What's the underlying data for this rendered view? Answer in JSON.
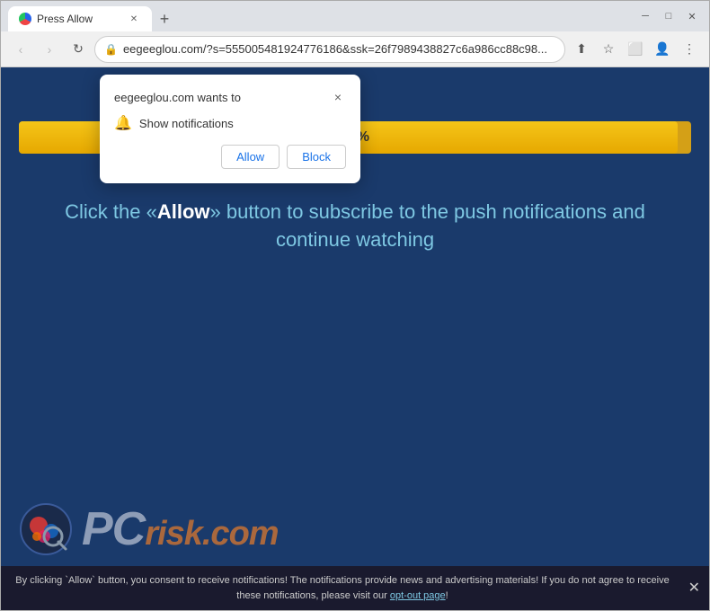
{
  "browser": {
    "tab_title": "Press Allow",
    "new_tab_label": "+",
    "address": "eegeeglou.com/?s=555005481924776186&ssk=26f7989438827c6a986cc88c98...",
    "nav": {
      "back_label": "‹",
      "forward_label": "›",
      "refresh_label": "↻"
    },
    "window_controls": {
      "minimize": "─",
      "maximize": "□",
      "close": "✕"
    }
  },
  "notification_popup": {
    "title": "eegeeglou.com wants to",
    "close_label": "×",
    "item_text": "Show notifications",
    "allow_label": "Allow",
    "block_label": "Block"
  },
  "page": {
    "progress_percent": "98%",
    "progress_fill_width": "98",
    "main_message_part1": "Click the «",
    "main_message_allow": "Allow",
    "main_message_part2": "» button to subscribe to the push notifications and continue watching",
    "logo_text_pc": "PC",
    "logo_text_risk": "risk",
    "logo_text_com": ".com"
  },
  "cookie_bar": {
    "text": "By clicking `Allow` button, you consent to receive notifications! The notifications provide news and advertising materials! If you do not agree to receive these notifications, please visit our ",
    "link_text": "opt-out page",
    "text_end": "!",
    "close_label": "✕"
  }
}
